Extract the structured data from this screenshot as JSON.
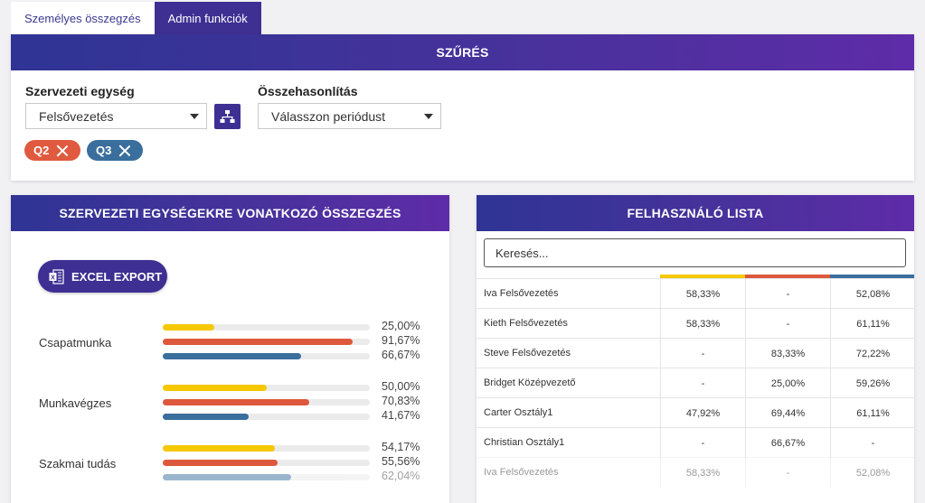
{
  "tabs": [
    {
      "label": "Személyes összegzés",
      "active": false
    },
    {
      "label": "Admin funkciók",
      "active": true
    }
  ],
  "filter": {
    "title": "SZŰRÉS",
    "org_unit_label": "Szervezeti egység",
    "org_unit_value": "Felsővezetés",
    "comparison_label": "Összehasonlítás",
    "comparison_placeholder": "Válasszon periódust",
    "chips": [
      {
        "label": "Q2",
        "color": "#e05a3f"
      },
      {
        "label": "Q3",
        "color": "#3a6e9c"
      }
    ]
  },
  "summary": {
    "title": "SZERVEZETI EGYSÉGEKRE VONATKOZÓ ÖSSZEGZÉS",
    "export_label": "EXCEL EXPORT",
    "series_colors": [
      "#f5c800",
      "#dd583c",
      "#3a6e9c"
    ],
    "categories": [
      {
        "name": "Csapatmunka",
        "values": [
          25.0,
          91.67,
          66.67
        ],
        "labels": [
          "25,00%",
          "91,67%",
          "66,67%"
        ]
      },
      {
        "name": "Munkavégzes",
        "values": [
          50.0,
          70.83,
          41.67
        ],
        "labels": [
          "50,00%",
          "70,83%",
          "41,67%"
        ]
      },
      {
        "name": "Szakmai tudás",
        "values": [
          54.17,
          55.56,
          62.04
        ],
        "labels": [
          "54,17%",
          "55,56%",
          "62,04%"
        ]
      }
    ]
  },
  "users": {
    "title": "FELHASZNÁLÓ LISTA",
    "search_placeholder": "Keresés...",
    "column_colors": [
      "#f5c800",
      "#dd583c",
      "#3a6e9c"
    ],
    "rows": [
      {
        "name": "Iva Felsővezetés",
        "c1": "58,33%",
        "c2": "-",
        "c3": "52,08%"
      },
      {
        "name": "Kieth Felsővezetés",
        "c1": "58,33%",
        "c2": "-",
        "c3": "61,11%"
      },
      {
        "name": "Steve Felsővezetés",
        "c1": "-",
        "c2": "83,33%",
        "c3": "72,22%"
      },
      {
        "name": "Bridget Középvezető",
        "c1": "-",
        "c2": "25,00%",
        "c3": "59,26%"
      },
      {
        "name": "Carter Osztály1",
        "c1": "47,92%",
        "c2": "69,44%",
        "c3": "61,11%"
      },
      {
        "name": "Christian Osztály1",
        "c1": "-",
        "c2": "66,67%",
        "c3": "-"
      },
      {
        "name": "Iva Felsővezetés",
        "c1": "58,33%",
        "c2": "-",
        "c3": "52,08%"
      }
    ]
  }
}
